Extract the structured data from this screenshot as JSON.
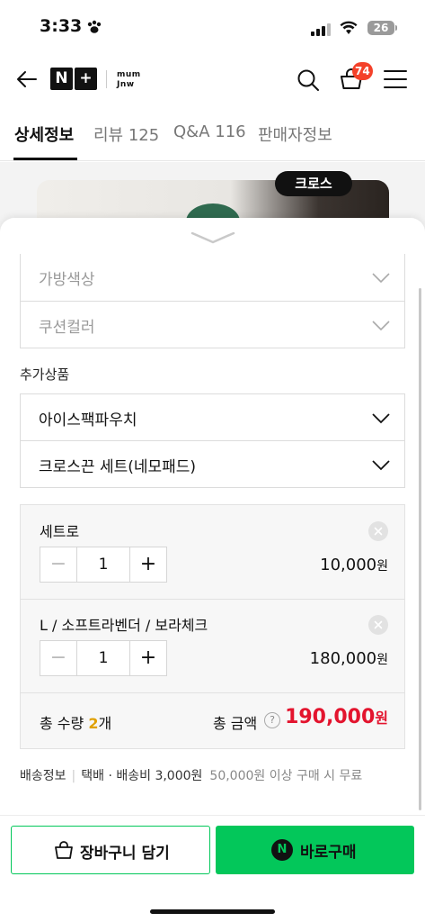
{
  "status": {
    "time": "3:33",
    "battery": "26"
  },
  "header": {
    "logo_n": "N",
    "logo_plus": "+",
    "brand": "mum\nJnw",
    "cart_count": "74"
  },
  "tabs": [
    {
      "label": "상세정보"
    },
    {
      "label": "리뷰 125"
    },
    {
      "label": "Q&A 116"
    },
    {
      "label": "판매자정보"
    }
  ],
  "product": {
    "badge": "크로스"
  },
  "options": {
    "bag_color": "가방색상",
    "cushion_color": "쿠션컬러"
  },
  "addon": {
    "section_label": "추가상품",
    "item1": "아이스팩파우치",
    "item2": "크로스끈 세트(네모패드)"
  },
  "selected": [
    {
      "name": "세트로",
      "qty": "1",
      "price": "10,000",
      "unit": "원"
    },
    {
      "name": "L / 소프트라벤더 / 보라체크",
      "qty": "1",
      "price": "180,000",
      "unit": "원"
    }
  ],
  "total": {
    "qty_prefix": "총 수량 ",
    "qty_count": "2",
    "qty_suffix": "개",
    "amount_label": "총 금액",
    "help": "?",
    "amount": "190,000",
    "unit": "원"
  },
  "shipping": {
    "label": "배송정보",
    "sep": "|",
    "detail": "택배 · 배송비 3,000원",
    "note": "50,000원 이상 구매 시 무료"
  },
  "buttons": {
    "cart": "장바구니 담기",
    "buy_icon": "N",
    "buy": "바로구매"
  },
  "colors": {
    "accent": "#03c75a",
    "price_red": "#e3142e",
    "badge": "#f4412a"
  }
}
